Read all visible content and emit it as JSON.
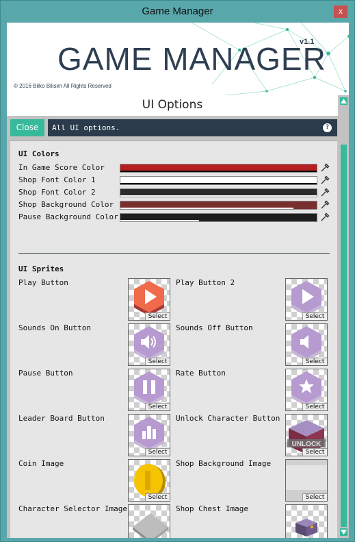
{
  "window": {
    "title": "Game Manager",
    "close_glyph": "x"
  },
  "banner": {
    "logo": "GAME MANAGER",
    "version": "v1.1",
    "copyright": "© 2016 Bilko Bilisim All Rights Reserved"
  },
  "section_title": "UI Options",
  "toolbar": {
    "close_label": "Close",
    "description": "All UI options.",
    "help_glyph": "?"
  },
  "ui_colors": {
    "heading": "UI Colors",
    "items": [
      {
        "label": "In Game Score Color",
        "color": "#b52020",
        "alpha": 1.0
      },
      {
        "label": "Shop Font Color 1",
        "color": "#ffffff",
        "alpha": 1.0
      },
      {
        "label": "Shop Font Color 2",
        "color": "#2b2b2b",
        "alpha": 1.0
      },
      {
        "label": "Shop Background Color",
        "color": "#7a2f2f",
        "alpha": 0.88
      },
      {
        "label": "Pause Background Color",
        "color": "#1e1e1e",
        "alpha": 0.4
      }
    ]
  },
  "ui_sprites": {
    "heading": "UI Sprites",
    "select_label": "Select",
    "items": [
      {
        "label": "Play Button",
        "icon": "play-hex-red-icon"
      },
      {
        "label": "Play Button 2",
        "icon": "play-hex-purple-icon"
      },
      {
        "label": "Sounds On Button",
        "icon": "sound-on-hex-icon"
      },
      {
        "label": "Sounds Off Button",
        "icon": "sound-off-hex-icon"
      },
      {
        "label": "Pause Button",
        "icon": "pause-hex-icon"
      },
      {
        "label": "Rate Button",
        "icon": "star-hex-icon"
      },
      {
        "label": "Leader Board Button",
        "icon": "leaderboard-hex-icon"
      },
      {
        "label": "Unlock Character Button",
        "icon": "unlock-box-icon",
        "sprite_text": "UNLOCK"
      },
      {
        "label": "Coin Image",
        "icon": "gold-coin-icon"
      },
      {
        "label": "Shop Background Image",
        "icon": "shop-background-icon"
      },
      {
        "label": "Character Selector Image",
        "icon": "selector-platform-icon"
      },
      {
        "label": "Shop Chest Image",
        "icon": "chest-icon"
      }
    ]
  },
  "colors": {
    "accent": "#37b99b",
    "dark": "#2c3b4b",
    "window": "#58a7ab"
  }
}
